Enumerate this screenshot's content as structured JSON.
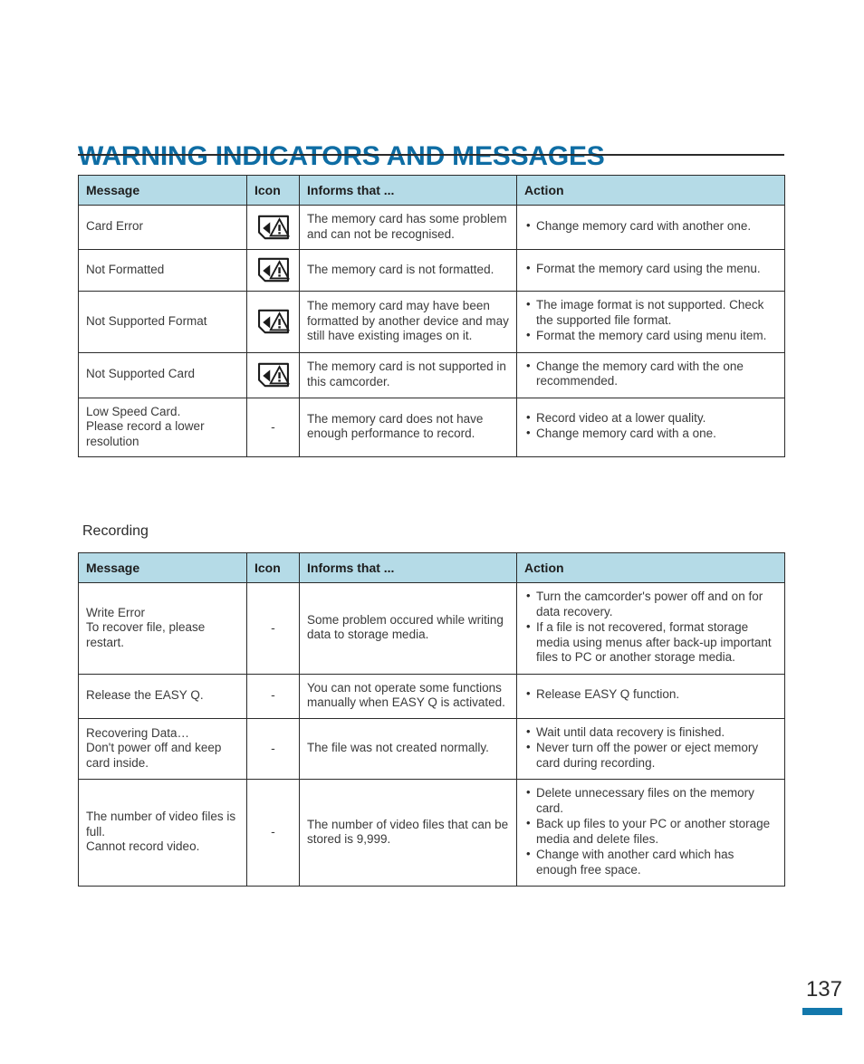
{
  "document": {
    "title": "WARNING INDICATORS AND MESSAGES",
    "page_number": "137",
    "accent_color": "#0e6da4",
    "header_band_color": "#b5dbe7",
    "page_bar_color": "#1378ac"
  },
  "columns": {
    "message": "Message",
    "icon": "Icon",
    "informs": "Informs that ...",
    "action": "Action"
  },
  "icons": {
    "card_warning": "memory-card-warning-icon",
    "none": "-"
  },
  "tables": [
    {
      "section_label": "",
      "rows": [
        {
          "message": "Card Error",
          "icon": "card-warning",
          "informs": "The memory card has some problem and can not be recognised.",
          "actions": [
            "Change memory card with another one."
          ]
        },
        {
          "message": "Not Formatted",
          "icon": "card-warning",
          "informs": "The memory card is not formatted.",
          "actions": [
            "Format the memory card using the menu."
          ]
        },
        {
          "message": "Not Supported Format",
          "icon": "card-warning",
          "informs": "The memory card may have been formatted by another device and may still have existing images on it.",
          "actions": [
            "The image format is not supported. Check the supported file format.",
            "Format the memory card using menu item."
          ]
        },
        {
          "message": "Not Supported Card",
          "icon": "card-warning",
          "informs": "The memory card is not supported in this camcorder.",
          "actions": [
            "Change the memory card with the one recommended."
          ]
        },
        {
          "message": "Low Speed Card.\nPlease record a lower resolution",
          "icon": "none",
          "informs": "The memory card does not have enough performance to record.",
          "actions": [
            "Record video at a lower quality.",
            "Change memory card with a one."
          ]
        }
      ]
    },
    {
      "section_label": "Recording",
      "rows": [
        {
          "message": "Write Error\nTo recover file, please restart.",
          "icon": "none",
          "informs": "Some problem occured while writing data to storage media.",
          "actions": [
            "Turn the camcorder's power off and on for data recovery.",
            "If a file is not recovered, format storage media using menus after back-up important files to PC or another storage media."
          ]
        },
        {
          "message": "Release the EASY Q.",
          "icon": "none",
          "informs": "You can not operate some functions manually when EASY Q is activated.",
          "actions": [
            "Release EASY Q function."
          ]
        },
        {
          "message": "Recovering Data…\nDon't power off and keep card inside.",
          "icon": "none",
          "informs": "The file was not created normally.",
          "actions": [
            "Wait until data recovery is finished.",
            "Never turn off the power or eject memory card during recording."
          ]
        },
        {
          "message": "The number of video files is full.\nCannot record video.",
          "icon": "none",
          "informs": "The number of video files that can be stored is 9,999.",
          "actions": [
            "Delete unnecessary files on the memory card.",
            "Back up files to your PC or another storage media and delete files.",
            "Change with another card which has enough free space."
          ]
        }
      ]
    }
  ]
}
